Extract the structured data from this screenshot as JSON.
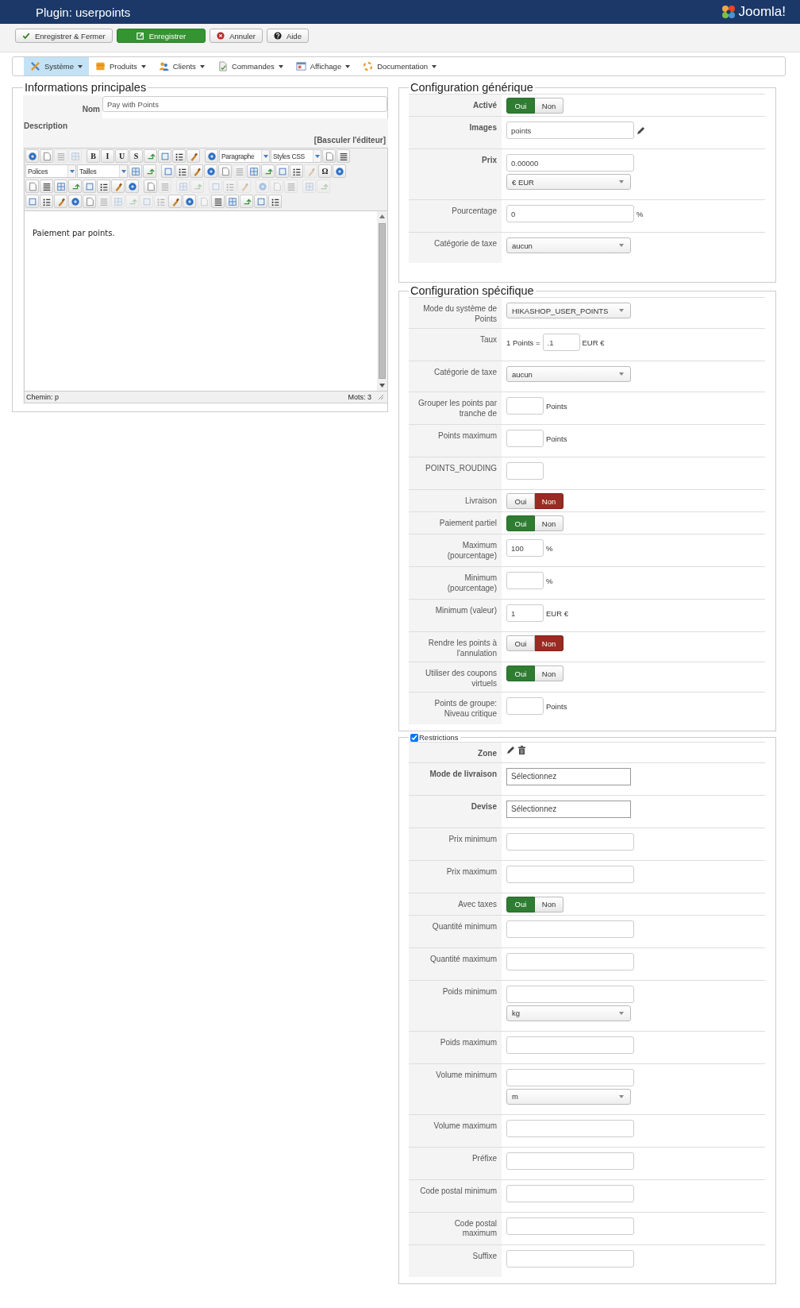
{
  "header": {
    "title": "Plugin: userpoints",
    "logo": "Joomla!"
  },
  "actions": [
    {
      "label": "Enregistrer & Fermer",
      "kind": "save-close"
    },
    {
      "label": "Enregistrer",
      "kind": "save"
    },
    {
      "label": "Annuler",
      "kind": "cancel"
    },
    {
      "label": "Aide",
      "kind": "help"
    }
  ],
  "menu": [
    {
      "label": "Système",
      "kind": "system",
      "selected": true
    },
    {
      "label": "Produits",
      "kind": "products",
      "selected": false
    },
    {
      "label": "Clients",
      "kind": "customers",
      "selected": false
    },
    {
      "label": "Commandes",
      "kind": "orders",
      "selected": false
    },
    {
      "label": "Affichage",
      "kind": "display",
      "selected": false
    },
    {
      "label": "Documentation",
      "kind": "docs",
      "selected": false
    }
  ],
  "main_info": {
    "legend": "Informations principales",
    "name_label": "Nom",
    "name_value": "Pay with Points",
    "description_label": "Description",
    "toggle_editor": "[Basculer l'éditeur]",
    "editor": {
      "content": "Paiement par points.",
      "path": "Chemin: p",
      "words": "Mots: 3",
      "toolbar": [
        [
          [
            {
              "kind": "button",
              "disabled": false
            },
            {
              "kind": "button",
              "disabled": false
            },
            {
              "kind": "button",
              "disabled": true
            },
            {
              "kind": "button",
              "disabled": true
            }
          ],
          [
            {
              "kind": "letter",
              "text": "B",
              "disabled": false
            },
            {
              "kind": "letter",
              "text": "I",
              "disabled": false
            },
            {
              "kind": "letter",
              "text": "U",
              "disabled": false
            },
            {
              "kind": "letter",
              "text": "S",
              "disabled": false
            },
            {
              "kind": "button",
              "disabled": false
            },
            {
              "kind": "button",
              "disabled": false
            },
            {
              "kind": "button",
              "disabled": false
            },
            {
              "kind": "button",
              "disabled": false
            }
          ],
          [
            {
              "kind": "button",
              "disabled": false
            },
            {
              "kind": "select",
              "text": "Paragraphe"
            },
            {
              "kind": "select",
              "text": "Styles CSS"
            },
            {
              "kind": "button",
              "disabled": false
            },
            {
              "kind": "button",
              "disabled": false
            }
          ]
        ],
        [
          [
            {
              "kind": "select",
              "text": "Polices"
            },
            {
              "kind": "select",
              "text": "Tailles"
            },
            {
              "kind": "button",
              "disabled": false
            },
            {
              "kind": "button",
              "disabled": false
            }
          ],
          [
            {
              "kind": "button",
              "disabled": false
            },
            {
              "kind": "button",
              "disabled": false
            },
            {
              "kind": "button",
              "disabled": false
            },
            {
              "kind": "button",
              "disabled": false
            },
            {
              "kind": "button",
              "disabled": false
            },
            {
              "kind": "button",
              "disabled": true
            },
            {
              "kind": "button",
              "disabled": false
            },
            {
              "kind": "button",
              "disabled": false
            },
            {
              "kind": "button",
              "disabled": false
            },
            {
              "kind": "button",
              "disabled": false
            },
            {
              "kind": "button",
              "disabled": true
            },
            {
              "kind": "letter",
              "text": "Ω",
              "disabled": false
            },
            {
              "kind": "button",
              "disabled": false
            }
          ]
        ],
        [
          [
            {
              "kind": "button",
              "disabled": false
            },
            {
              "kind": "button",
              "disabled": false
            },
            {
              "kind": "button",
              "disabled": false
            },
            {
              "kind": "button",
              "disabled": false
            },
            {
              "kind": "button",
              "disabled": false
            },
            {
              "kind": "button",
              "disabled": false
            },
            {
              "kind": "button",
              "disabled": false
            },
            {
              "kind": "button",
              "disabled": false
            }
          ],
          [
            {
              "kind": "button",
              "disabled": false
            },
            {
              "kind": "button",
              "disabled": true
            }
          ],
          [
            {
              "kind": "button",
              "disabled": true
            },
            {
              "kind": "button",
              "disabled": true
            }
          ],
          [
            {
              "kind": "button",
              "disabled": true
            },
            {
              "kind": "button",
              "disabled": true
            },
            {
              "kind": "button",
              "disabled": true
            }
          ],
          [
            {
              "kind": "button",
              "disabled": true
            },
            {
              "kind": "button",
              "disabled": true
            },
            {
              "kind": "button",
              "disabled": true
            }
          ],
          [
            {
              "kind": "button",
              "disabled": true
            },
            {
              "kind": "button",
              "disabled": true
            }
          ]
        ],
        [
          [
            {
              "kind": "button",
              "disabled": false
            },
            {
              "kind": "button",
              "disabled": false
            },
            {
              "kind": "button",
              "disabled": false
            },
            {
              "kind": "button",
              "disabled": false
            },
            {
              "kind": "button",
              "disabled": false
            },
            {
              "kind": "button",
              "disabled": true
            },
            {
              "kind": "button",
              "disabled": true
            },
            {
              "kind": "button",
              "disabled": true
            },
            {
              "kind": "button",
              "disabled": true
            },
            {
              "kind": "button",
              "disabled": true
            },
            {
              "kind": "button",
              "disabled": false
            },
            {
              "kind": "button",
              "disabled": false
            },
            {
              "kind": "button",
              "disabled": true
            },
            {
              "kind": "button",
              "disabled": false
            },
            {
              "kind": "button",
              "disabled": false
            },
            {
              "kind": "button",
              "disabled": false
            },
            {
              "kind": "button",
              "disabled": false
            },
            {
              "kind": "button",
              "disabled": false
            }
          ]
        ]
      ]
    }
  },
  "sections": [
    {
      "legend": "Configuration générique",
      "rows": [
        {
          "label": "Activé",
          "bold": true,
          "lines": [
            [
              {
                "kind": "toggle",
                "options": [
                  {
                    "label": "Oui",
                    "selected": true
                  },
                  {
                    "label": "Non",
                    "selected": false
                  }
                ]
              }
            ]
          ]
        },
        {
          "label": "Images",
          "bold": true,
          "lines": [
            [
              {
                "kind": "input",
                "value": "points"
              },
              {
                "kind": "edit-action"
              }
            ]
          ]
        },
        {
          "label": "Prix",
          "bold": true,
          "lines": [
            [
              {
                "kind": "input",
                "value": "0.00000"
              }
            ],
            [
              {
                "kind": "select",
                "value": "€ EUR"
              }
            ]
          ]
        },
        {
          "label": "Pourcentage",
          "bold": false,
          "lines": [
            [
              {
                "kind": "input",
                "value": "0"
              },
              {
                "kind": "text",
                "value": "%"
              }
            ]
          ]
        },
        {
          "label": "Catégorie de taxe",
          "bold": false,
          "lines": [
            [
              {
                "kind": "select",
                "value": "aucun"
              }
            ]
          ]
        }
      ]
    },
    {
      "legend": "Configuration spécifique",
      "rows": [
        {
          "label": "Mode du système de\nPoints",
          "bold": false,
          "lines": [
            [
              {
                "kind": "select",
                "value": "HIKASHOP_USER_POINTS"
              }
            ]
          ]
        },
        {
          "label": "Taux",
          "bold": false,
          "lines": [
            [
              {
                "kind": "text",
                "value": "1 Points ="
              },
              {
                "kind": "short-input",
                "value": ".1"
              },
              {
                "kind": "text",
                "value": "EUR €"
              }
            ]
          ]
        },
        {
          "label": "Catégorie de taxe",
          "bold": false,
          "lines": [
            [
              {
                "kind": "select",
                "value": "aucun"
              }
            ]
          ]
        },
        {
          "label": "Grouper les points par\ntranche de",
          "bold": false,
          "lines": [
            [
              {
                "kind": "short-input"
              },
              {
                "kind": "text",
                "value": "Points"
              }
            ]
          ]
        },
        {
          "label": "Points maximum",
          "bold": false,
          "lines": [
            [
              {
                "kind": "short-input"
              },
              {
                "kind": "text",
                "value": "Points"
              }
            ]
          ]
        },
        {
          "label": "POINTS_ROUDING",
          "bold": false,
          "lines": [
            [
              {
                "kind": "short-input"
              }
            ]
          ]
        },
        {
          "label": "Livraison",
          "bold": false,
          "lines": [
            [
              {
                "kind": "toggle",
                "options": [
                  {
                    "label": "Oui",
                    "selected": false
                  },
                  {
                    "label": "Non",
                    "selected": true
                  }
                ]
              }
            ]
          ]
        },
        {
          "label": "Paiement partiel",
          "bold": false,
          "lines": [
            [
              {
                "kind": "toggle",
                "options": [
                  {
                    "label": "Oui",
                    "selected": true
                  },
                  {
                    "label": "Non",
                    "selected": false
                  }
                ]
              }
            ]
          ]
        },
        {
          "label": "Maximum\n(pourcentage)",
          "bold": false,
          "lines": [
            [
              {
                "kind": "short-input",
                "value": "100"
              },
              {
                "kind": "text",
                "value": "%"
              }
            ]
          ]
        },
        {
          "label": "Minimum\n(pourcentage)",
          "bold": false,
          "lines": [
            [
              {
                "kind": "short-input"
              },
              {
                "kind": "text",
                "value": "%"
              }
            ]
          ]
        },
        {
          "label": "Minimum (valeur)",
          "bold": false,
          "lines": [
            [
              {
                "kind": "short-input",
                "value": "1"
              },
              {
                "kind": "text",
                "value": "EUR €"
              }
            ]
          ]
        },
        {
          "label": "Rendre les points à\nl'annulation",
          "bold": false,
          "lines": [
            [
              {
                "kind": "toggle",
                "options": [
                  {
                    "label": "Oui",
                    "selected": false
                  },
                  {
                    "label": "Non",
                    "selected": true
                  }
                ]
              }
            ]
          ]
        },
        {
          "label": "Utiliser des coupons\nvirtuels",
          "bold": false,
          "lines": [
            [
              {
                "kind": "toggle",
                "options": [
                  {
                    "label": "Oui",
                    "selected": true
                  },
                  {
                    "label": "Non",
                    "selected": false
                  }
                ]
              }
            ]
          ]
        },
        {
          "label": "Points de groupe:\nNiveau critique",
          "bold": false,
          "lines": [
            [
              {
                "kind": "short-input"
              },
              {
                "kind": "text",
                "value": "Points"
              }
            ]
          ]
        }
      ]
    },
    {
      "legend": "Restrictions",
      "checked": true,
      "rows": [
        {
          "label": "Zone",
          "bold": true,
          "lines": [
            [
              {
                "kind": "edit-action"
              },
              {
                "kind": "delete-action"
              }
            ]
          ]
        },
        {
          "label": "Mode de livraison",
          "bold": true,
          "lines": [
            [
              {
                "kind": "picker",
                "value": "Sélectionnez"
              }
            ]
          ]
        },
        {
          "label": "Devise",
          "bold": true,
          "lines": [
            [
              {
                "kind": "picker",
                "value": "Sélectionnez"
              }
            ]
          ]
        },
        {
          "label": "Prix minimum",
          "bold": false,
          "lines": [
            [
              {
                "kind": "input"
              }
            ]
          ]
        },
        {
          "label": "Prix maximum",
          "bold": false,
          "lines": [
            [
              {
                "kind": "input"
              }
            ]
          ]
        },
        {
          "label": "Avec taxes",
          "bold": false,
          "lines": [
            [
              {
                "kind": "toggle",
                "options": [
                  {
                    "label": "Oui",
                    "selected": true
                  },
                  {
                    "label": "Non",
                    "selected": false
                  }
                ]
              }
            ]
          ]
        },
        {
          "label": "Quantité minimum",
          "bold": false,
          "lines": [
            [
              {
                "kind": "input"
              }
            ]
          ]
        },
        {
          "label": "Quantité maximum",
          "bold": false,
          "lines": [
            [
              {
                "kind": "input"
              }
            ]
          ]
        },
        {
          "label": "Poids minimum",
          "bold": false,
          "lines": [
            [
              {
                "kind": "input"
              }
            ],
            [
              {
                "kind": "select",
                "value": "kg"
              }
            ]
          ]
        },
        {
          "label": "Poids maximum",
          "bold": false,
          "lines": [
            [
              {
                "kind": "input"
              }
            ]
          ]
        },
        {
          "label": "Volume minimum",
          "bold": false,
          "lines": [
            [
              {
                "kind": "input"
              }
            ],
            [
              {
                "kind": "select",
                "value": "m"
              }
            ]
          ]
        },
        {
          "label": "Volume maximum",
          "bold": false,
          "lines": [
            [
              {
                "kind": "input"
              }
            ]
          ]
        },
        {
          "label": "Préfixe",
          "bold": false,
          "lines": [
            [
              {
                "kind": "input"
              }
            ]
          ]
        },
        {
          "label": "Code postal minimum",
          "bold": false,
          "lines": [
            [
              {
                "kind": "input"
              }
            ]
          ]
        },
        {
          "label": "Code postal\nmaximum",
          "bold": false,
          "lines": [
            [
              {
                "kind": "input"
              }
            ]
          ]
        },
        {
          "label": "Suffixe",
          "bold": false,
          "lines": [
            [
              {
                "kind": "input"
              }
            ]
          ]
        }
      ]
    }
  ]
}
